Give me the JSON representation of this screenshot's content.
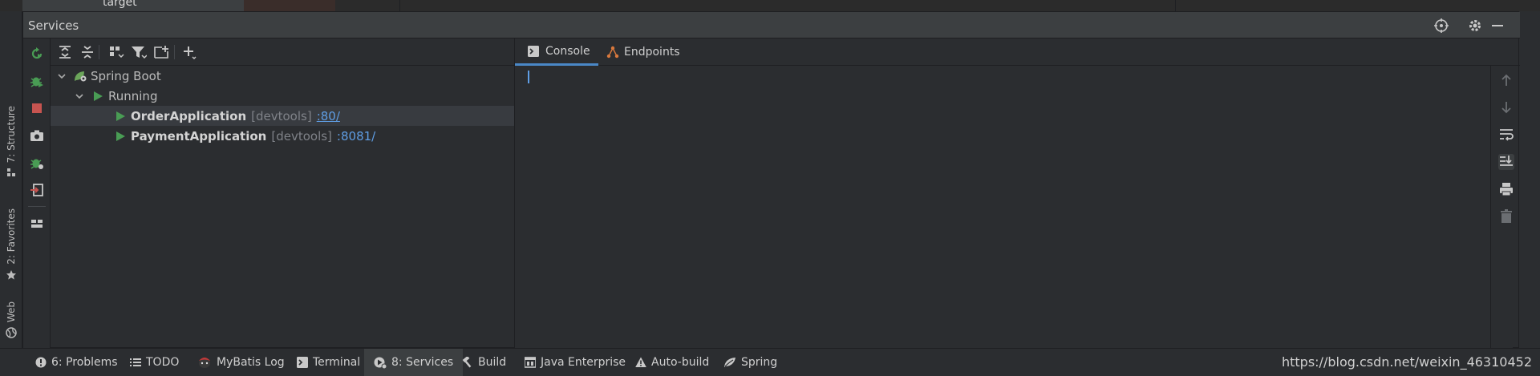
{
  "top_strip": {
    "text": "target"
  },
  "left_strip": {
    "tabs": [
      {
        "label": "7: Structure",
        "icon": "structure-icon"
      },
      {
        "label": "2: Favorites",
        "icon": "star-icon"
      },
      {
        "label": "Web",
        "icon": "globe-icon"
      }
    ]
  },
  "services": {
    "title": "Services",
    "header_icons": [
      "crosshair-icon",
      "gear-icon",
      "minimize-icon"
    ],
    "actions": [
      "rerun-icon",
      "debug-icon",
      "stop-icon",
      "camera-icon",
      "debug-config-icon",
      "login-icon",
      "layout-icon"
    ],
    "toolbar": [
      "expand-all-icon",
      "collapse-all-icon",
      "group-icon",
      "filter-icon",
      "new-tab-icon",
      "add-icon"
    ],
    "tree": {
      "root": "Spring Boot",
      "group": "Running",
      "apps": [
        {
          "name": "OrderApplication",
          "tag": "[devtools]",
          "port": ":80/"
        },
        {
          "name": "PaymentApplication",
          "tag": "[devtools]",
          "port": ":8081/"
        }
      ]
    },
    "console_tabs": [
      {
        "label": "Console",
        "icon": "console-icon",
        "active": true
      },
      {
        "label": "Endpoints",
        "icon": "endpoints-icon",
        "active": false
      }
    ],
    "console_side": [
      "up-arrow-icon",
      "down-arrow-icon",
      "soft-wrap-icon",
      "scroll-end-icon",
      "print-icon",
      "trash-icon"
    ]
  },
  "bottom_bar": {
    "tabs": [
      {
        "label": "6: Problems",
        "icon": "problems-icon"
      },
      {
        "label": "TODO",
        "icon": "list-icon"
      },
      {
        "label": "MyBatis Log",
        "icon": "mybatis-icon"
      },
      {
        "label": "Terminal",
        "icon": "terminal-icon"
      },
      {
        "label": "8: Services",
        "icon": "services-icon",
        "active": true
      },
      {
        "label": "Build",
        "icon": "hammer-icon"
      },
      {
        "label": "Java Enterprise",
        "icon": "java-enterprise-icon"
      },
      {
        "label": "Auto-build",
        "icon": "warning-icon"
      },
      {
        "label": "Spring",
        "icon": "spring-leaf-icon"
      }
    ],
    "watermark": "https://blog.csdn.net/weixin_46310452"
  },
  "colors": {
    "accent": "#4a88c7",
    "run_green": "#499c54",
    "stop_red": "#c75450",
    "link": "#5f9ee5"
  }
}
